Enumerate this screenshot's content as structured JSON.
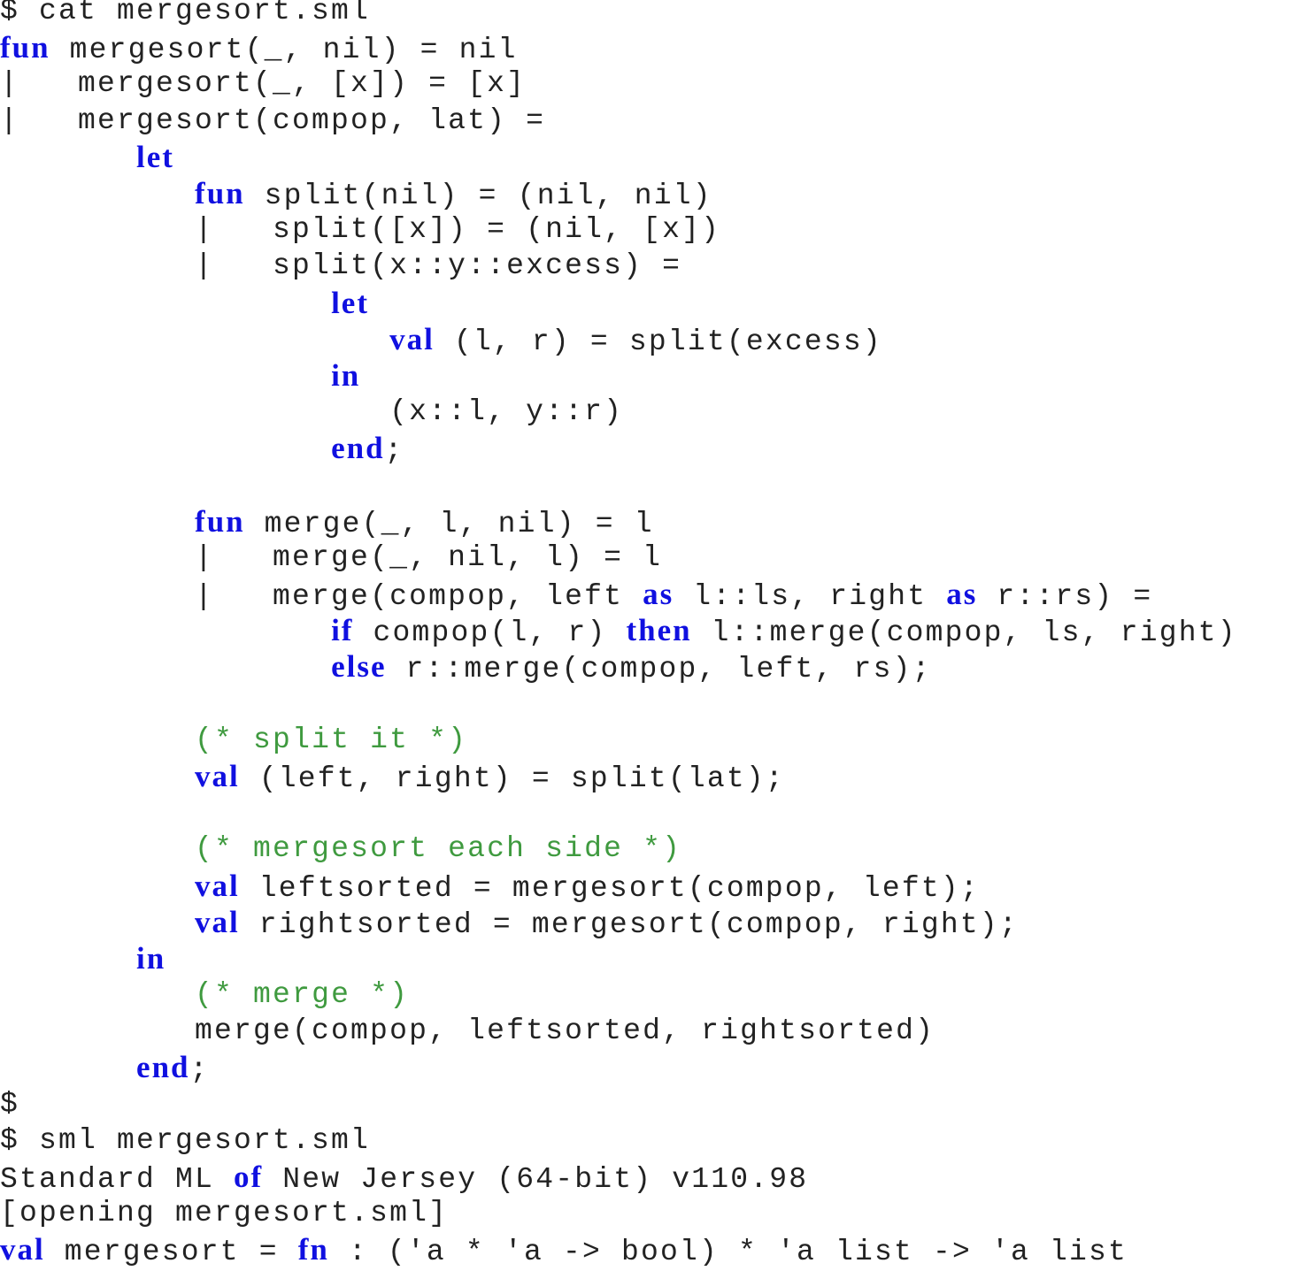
{
  "terminal": {
    "colors": {
      "keyword": "#1010e0",
      "comment": "#3f9a3f",
      "text": "#222222",
      "background": "#ffffff"
    },
    "lines": [
      [
        {
          "t": "tx",
          "s": "$ cat mergesort.sml"
        }
      ],
      [
        {
          "t": "kw",
          "s": "fun"
        },
        {
          "t": "tx",
          "s": " mergesort(_, nil) = nil"
        }
      ],
      [
        {
          "t": "tx",
          "s": "|   mergesort(_, [x]) = [x]"
        }
      ],
      [
        {
          "t": "tx",
          "s": "|   mergesort(compop, lat) ="
        }
      ],
      [
        {
          "t": "tx",
          "s": "       "
        },
        {
          "t": "kw",
          "s": "let"
        }
      ],
      [
        {
          "t": "tx",
          "s": "          "
        },
        {
          "t": "kw",
          "s": "fun"
        },
        {
          "t": "tx",
          "s": " split(nil) = (nil, nil)"
        }
      ],
      [
        {
          "t": "tx",
          "s": "          |   split([x]) = (nil, [x])"
        }
      ],
      [
        {
          "t": "tx",
          "s": "          |   split(x::y::excess) ="
        }
      ],
      [
        {
          "t": "tx",
          "s": "                 "
        },
        {
          "t": "kw",
          "s": "let"
        }
      ],
      [
        {
          "t": "tx",
          "s": "                    "
        },
        {
          "t": "kw",
          "s": "val"
        },
        {
          "t": "tx",
          "s": " (l, r) = split(excess)"
        }
      ],
      [
        {
          "t": "tx",
          "s": "                 "
        },
        {
          "t": "kw",
          "s": "in"
        }
      ],
      [
        {
          "t": "tx",
          "s": "                    (x::l, y::r)"
        }
      ],
      [
        {
          "t": "tx",
          "s": "                 "
        },
        {
          "t": "kw",
          "s": "end"
        },
        {
          "t": "tx",
          "s": ";"
        }
      ],
      [
        {
          "t": "tx",
          "s": ""
        }
      ],
      [
        {
          "t": "tx",
          "s": "          "
        },
        {
          "t": "kw",
          "s": "fun"
        },
        {
          "t": "tx",
          "s": " merge(_, l, nil) = l"
        }
      ],
      [
        {
          "t": "tx",
          "s": "          |   merge(_, nil, l) = l"
        }
      ],
      [
        {
          "t": "tx",
          "s": "          |   merge(compop, left "
        },
        {
          "t": "kw",
          "s": "as"
        },
        {
          "t": "tx",
          "s": " l::ls, right "
        },
        {
          "t": "kw",
          "s": "as"
        },
        {
          "t": "tx",
          "s": " r::rs) ="
        }
      ],
      [
        {
          "t": "tx",
          "s": "                 "
        },
        {
          "t": "kw",
          "s": "if"
        },
        {
          "t": "tx",
          "s": " compop(l, r) "
        },
        {
          "t": "kw",
          "s": "then"
        },
        {
          "t": "tx",
          "s": " l::merge(compop, ls, right)"
        }
      ],
      [
        {
          "t": "tx",
          "s": "                 "
        },
        {
          "t": "kw",
          "s": "else"
        },
        {
          "t": "tx",
          "s": " r::merge(compop, left, rs);"
        }
      ],
      [
        {
          "t": "tx",
          "s": ""
        }
      ],
      [
        {
          "t": "tx",
          "s": "          "
        },
        {
          "t": "cm",
          "s": "(* split it *)"
        }
      ],
      [
        {
          "t": "tx",
          "s": "          "
        },
        {
          "t": "kw",
          "s": "val"
        },
        {
          "t": "tx",
          "s": " (left, right) = split(lat);"
        }
      ],
      [
        {
          "t": "tx",
          "s": ""
        }
      ],
      [
        {
          "t": "tx",
          "s": "          "
        },
        {
          "t": "cm",
          "s": "(* mergesort each side *)"
        }
      ],
      [
        {
          "t": "tx",
          "s": "          "
        },
        {
          "t": "kw",
          "s": "val"
        },
        {
          "t": "tx",
          "s": " leftsorted = mergesort(compop, left);"
        }
      ],
      [
        {
          "t": "tx",
          "s": "          "
        },
        {
          "t": "kw",
          "s": "val"
        },
        {
          "t": "tx",
          "s": " rightsorted = mergesort(compop, right);"
        }
      ],
      [
        {
          "t": "tx",
          "s": "       "
        },
        {
          "t": "kw",
          "s": "in"
        }
      ],
      [
        {
          "t": "tx",
          "s": "          "
        },
        {
          "t": "cm",
          "s": "(* merge *)"
        }
      ],
      [
        {
          "t": "tx",
          "s": "          merge(compop, leftsorted, rightsorted)"
        }
      ],
      [
        {
          "t": "tx",
          "s": "       "
        },
        {
          "t": "kw",
          "s": "end"
        },
        {
          "t": "tx",
          "s": ";"
        }
      ],
      [
        {
          "t": "tx",
          "s": "$"
        }
      ],
      [
        {
          "t": "tx",
          "s": "$ sml mergesort.sml"
        }
      ],
      [
        {
          "t": "tx",
          "s": "Standard ML "
        },
        {
          "t": "kw",
          "s": "of"
        },
        {
          "t": "tx",
          "s": " New Jersey (64-bit) v110.98"
        }
      ],
      [
        {
          "t": "tx",
          "s": "[opening mergesort.sml]"
        }
      ],
      [
        {
          "t": "kw",
          "s": "val"
        },
        {
          "t": "tx",
          "s": " mergesort = "
        },
        {
          "t": "kw",
          "s": "fn"
        },
        {
          "t": "tx",
          "s": " : ('a * 'a -> bool) * 'a list -> 'a list"
        }
      ]
    ]
  }
}
